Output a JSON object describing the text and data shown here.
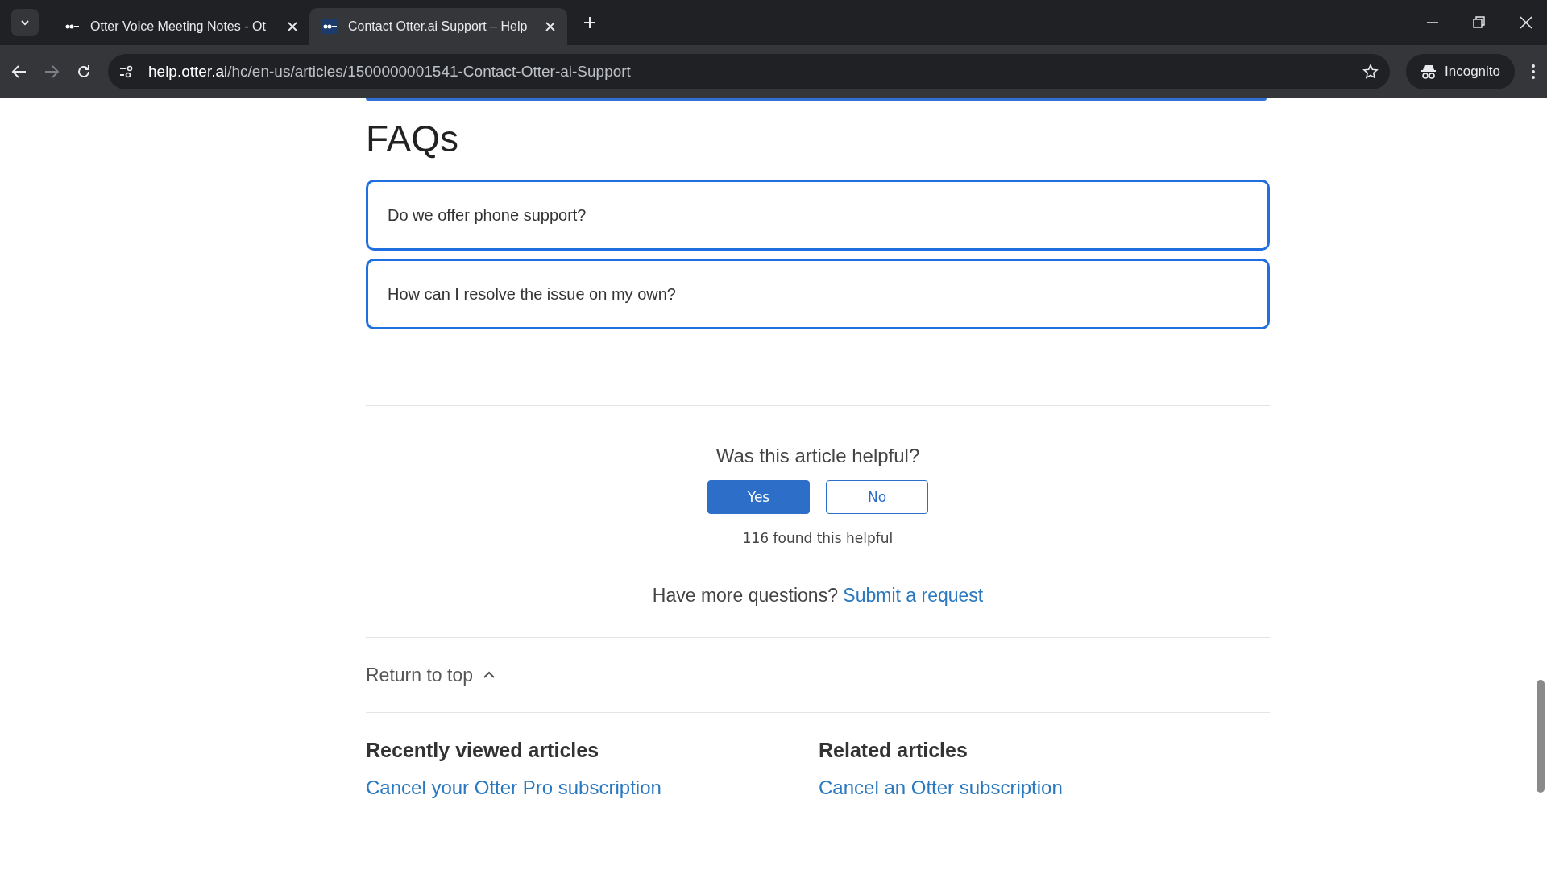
{
  "browser": {
    "tabs": [
      {
        "title": "Otter Voice Meeting Notes - Ot",
        "selected": false
      },
      {
        "title": "Contact Otter.ai Support – Help",
        "selected": true
      }
    ],
    "address": {
      "host": "help.otter.ai",
      "path": "/hc/en-us/articles/1500000001541-Contact-Otter-ai-Support"
    },
    "profile": "Incognito"
  },
  "faq": {
    "heading": "FAQs",
    "items": [
      {
        "question": "Do we offer phone support?"
      },
      {
        "question": "How can I resolve the issue on my own?"
      }
    ]
  },
  "feedback": {
    "question": "Was this article helpful?",
    "buttons": [
      {
        "label": "Yes",
        "selected": true
      },
      {
        "label": "No",
        "selected": false
      }
    ],
    "count": "116 found this helpful"
  },
  "more": {
    "text": "Have more questions?",
    "link": "Submit a request"
  },
  "return_to_top": "Return to top",
  "recently_viewed": {
    "heading": "Recently viewed articles",
    "links": [
      "Cancel your Otter Pro subscription"
    ]
  },
  "related": {
    "heading": "Related articles",
    "links": [
      "Cancel an Otter subscription"
    ]
  }
}
